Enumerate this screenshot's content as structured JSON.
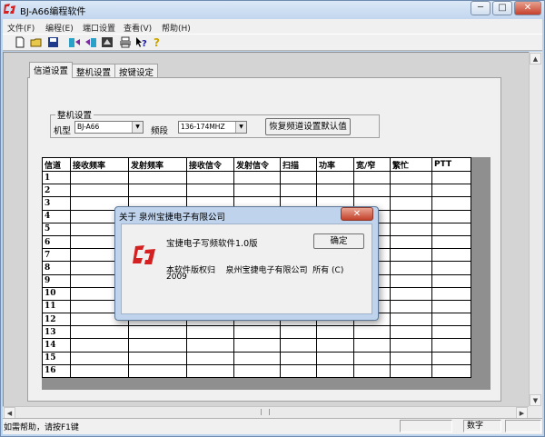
{
  "window": {
    "title": "BJ-A66编程软件",
    "controls": {
      "minimize": "─",
      "maximize": "□",
      "close": "✕"
    }
  },
  "menu": [
    "文件(F)",
    "编程(E)",
    "端口设置",
    "查看(V)",
    "帮助(H)"
  ],
  "toolbar_icons": [
    "new-file-icon",
    "open-folder-icon",
    "save-icon",
    "read-radio-icon",
    "write-radio-icon",
    "settings-icon",
    "print-icon",
    "context-help-icon",
    "about-icon"
  ],
  "tabs": [
    "信道设置",
    "整机设置",
    "按键设定"
  ],
  "group": {
    "title": "整机设置",
    "model_label": "机型",
    "model_value": "BJ-A66",
    "band_label": "频段",
    "band_value": "136-174MHZ",
    "reset_button": "恢复频道设置默认值"
  },
  "table": {
    "headers": [
      "信道",
      "接收频率",
      "发射频率",
      "接收信令",
      "发射信令",
      "扫描",
      "功率",
      "宽/窄",
      "繁忙",
      "PTT"
    ],
    "rows": [
      "1",
      "2",
      "3",
      "4",
      "5",
      "6",
      "7",
      "8",
      "9",
      "10",
      "11",
      "12",
      "13",
      "14",
      "15",
      "16"
    ]
  },
  "dialog": {
    "title": "关于 泉州宝捷电子有限公司",
    "close": "✕",
    "version": "宝捷电子写频软件1.0版",
    "ok_button": "确定",
    "copyright": "本软件版权归    泉州宝捷电子有限公司  所有 (C)",
    "year": "2009"
  },
  "statusbar": {
    "help": "如需帮助，请按F1键",
    "num": "数字"
  },
  "colors": {
    "frame": "#bcd4ee",
    "logo_red": "#d42020",
    "dialog_frame": "#bfd3ec"
  }
}
